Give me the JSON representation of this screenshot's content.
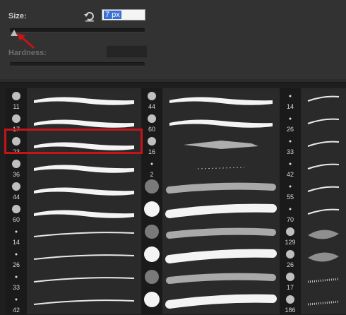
{
  "panel": {
    "size_label": "Size:",
    "size_value": "7 px",
    "hardness_label": "Hardness:",
    "reset_icon": "rotate-reset-icon"
  },
  "colors": {
    "selection_border": "#c41418",
    "annotation_arrow": "#c41418",
    "input_highlight": "#3b6fd4"
  },
  "slider": {
    "size_fraction": 0.02
  },
  "brushes": {
    "column1": [
      {
        "size": "11",
        "style": "hard-wavy"
      },
      {
        "size": "17",
        "style": "hard-wavy"
      },
      {
        "size": "23",
        "style": "hard-wavy",
        "selected": true
      },
      {
        "size": "36",
        "style": "hard-wavy"
      },
      {
        "size": "44",
        "style": "hard-wavy"
      },
      {
        "size": "60",
        "style": "hard-wavy"
      },
      {
        "size": "14",
        "style": "thin-taper"
      },
      {
        "size": "26",
        "style": "thin-taper"
      },
      {
        "size": "33",
        "style": "thin-taper"
      },
      {
        "size": "42",
        "style": "thin-taper"
      }
    ],
    "column2": [
      {
        "size": "44",
        "style": "hard-wavy"
      },
      {
        "size": "60",
        "style": "hard-wavy"
      },
      {
        "size": "16",
        "style": "texture"
      },
      {
        "size": "2",
        "style": "dotted"
      },
      {
        "size": "",
        "style": "soft-round"
      },
      {
        "size": "",
        "style": "hard-round"
      },
      {
        "size": "",
        "style": "soft-round"
      },
      {
        "size": "",
        "style": "hard-round"
      },
      {
        "size": "",
        "style": "soft-round"
      },
      {
        "size": "",
        "style": "hard-round"
      }
    ],
    "column3": [
      {
        "size": "14",
        "style": "thin"
      },
      {
        "size": "26",
        "style": "thin"
      },
      {
        "size": "33",
        "style": "thin"
      },
      {
        "size": "42",
        "style": "thin"
      },
      {
        "size": "55",
        "style": "thin"
      },
      {
        "size": "70",
        "style": "thin"
      },
      {
        "size": "129",
        "style": "cloud"
      },
      {
        "size": "26",
        "style": "cloud"
      },
      {
        "size": "17",
        "style": "spray"
      },
      {
        "size": "186",
        "style": "spray"
      }
    ]
  }
}
